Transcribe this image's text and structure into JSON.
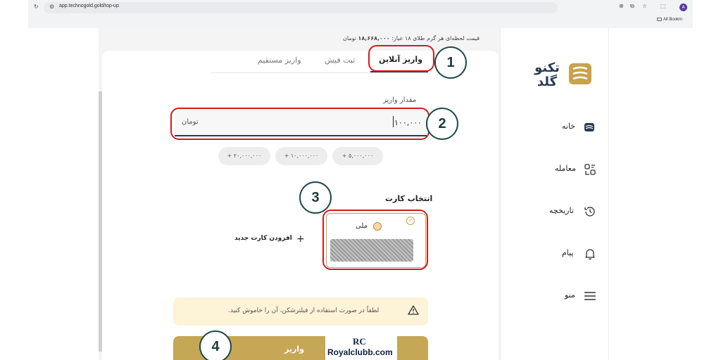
{
  "browser": {
    "url": "app.technogold.gold/top-up",
    "avatar": "A",
    "bookmarks": "All Bookm"
  },
  "price": {
    "label": "قیمت لحظه‌ای هر گرم طلای ۱۸ عیار:",
    "value": "۱۸,۶۶۸,۰۰۰",
    "unit": "تومان"
  },
  "tabs": [
    {
      "label": "واریز آنلاین",
      "active": true
    },
    {
      "label": "ثبت فیش",
      "active": false
    },
    {
      "label": "واریز مستقیم",
      "active": false
    }
  ],
  "amount": {
    "label": "مقدار واریز",
    "value": "۱۰۰,۰۰۰",
    "unit": "تومان"
  },
  "chips": [
    "+ ۵,۰۰۰,۰۰۰",
    "+ ۱۰,۰۰۰,۰۰۰",
    "+ ۲۰,۰۰۰,۰۰۰"
  ],
  "card_select": {
    "label": "انتخاب کارت",
    "bank_name": "ملی",
    "add_card": "افزودن کارت جدید"
  },
  "warning": "لطفاً در صورت استفاده از فیلترشکن، آن را خاموش کنید.",
  "submit": "واریز",
  "sidebar": {
    "brand_top": "تکنو",
    "brand_bottom": "گلد",
    "items": [
      {
        "label": "خانه",
        "icon": "home-icon"
      },
      {
        "label": "معامله",
        "icon": "trade-icon"
      },
      {
        "label": "تاریخچه",
        "icon": "history-icon"
      },
      {
        "label": "پیام",
        "icon": "bell-icon"
      },
      {
        "label": "منو",
        "icon": "menu-icon"
      }
    ]
  },
  "annotations": [
    "1",
    "2",
    "3",
    "4"
  ],
  "watermark": {
    "logo": "RC",
    "text": "Royalclubb.com"
  },
  "colors": {
    "gold": "#c6a756",
    "navy": "#2b3a55",
    "annotation_red": "#d21c1c",
    "annotation_teal": "#1e4a4a"
  }
}
